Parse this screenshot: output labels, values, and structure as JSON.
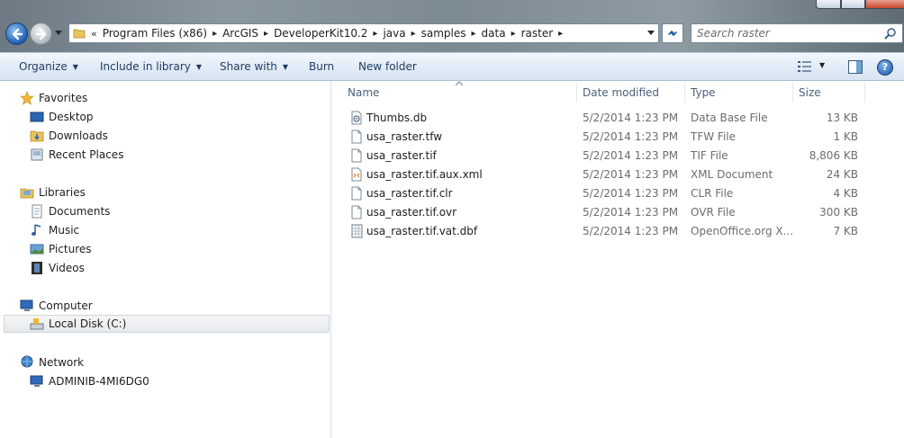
{
  "address": {
    "overflow": "«",
    "crumbs": [
      "Program Files (x86)",
      "ArcGIS",
      "DeveloperKit10.2",
      "java",
      "samples",
      "data",
      "raster"
    ]
  },
  "search": {
    "placeholder": "Search raster"
  },
  "toolbar": {
    "organize": "Organize",
    "include_in_library": "Include in library",
    "share_with": "Share with",
    "burn": "Burn",
    "new_folder": "New folder"
  },
  "nav": {
    "favorites": "Favorites",
    "desktop": "Desktop",
    "downloads": "Downloads",
    "recent_places": "Recent Places",
    "libraries": "Libraries",
    "documents": "Documents",
    "music": "Music",
    "pictures": "Pictures",
    "videos": "Videos",
    "computer": "Computer",
    "local_disk": "Local Disk (C:)",
    "network": "Network",
    "network_pc": "ADMINIB-4MI6DG0"
  },
  "columns": {
    "name": "Name",
    "date_modified": "Date modified",
    "type": "Type",
    "size": "Size"
  },
  "files": [
    {
      "name": "Thumbs.db",
      "date": "5/2/2014 1:23 PM",
      "type": "Data Base File",
      "size": "13 KB",
      "icon": "gear-file-icon"
    },
    {
      "name": "usa_raster.tfw",
      "date": "5/2/2014 1:23 PM",
      "type": "TFW File",
      "size": "1 KB",
      "icon": "blank-file-icon"
    },
    {
      "name": "usa_raster.tif",
      "date": "5/2/2014 1:23 PM",
      "type": "TIF File",
      "size": "8,806 KB",
      "icon": "blank-file-icon"
    },
    {
      "name": "usa_raster.tif.aux.xml",
      "date": "5/2/2014 1:23 PM",
      "type": "XML Document",
      "size": "24 KB",
      "icon": "xml-file-icon"
    },
    {
      "name": "usa_raster.tif.clr",
      "date": "5/2/2014 1:23 PM",
      "type": "CLR File",
      "size": "4 KB",
      "icon": "blank-file-icon"
    },
    {
      "name": "usa_raster.tif.ovr",
      "date": "5/2/2014 1:23 PM",
      "type": "OVR File",
      "size": "300 KB",
      "icon": "blank-file-icon"
    },
    {
      "name": "usa_raster.tif.vat.dbf",
      "date": "5/2/2014 1:23 PM",
      "type": "OpenOffice.org X...",
      "size": "7 KB",
      "icon": "spreadsheet-file-icon"
    }
  ]
}
